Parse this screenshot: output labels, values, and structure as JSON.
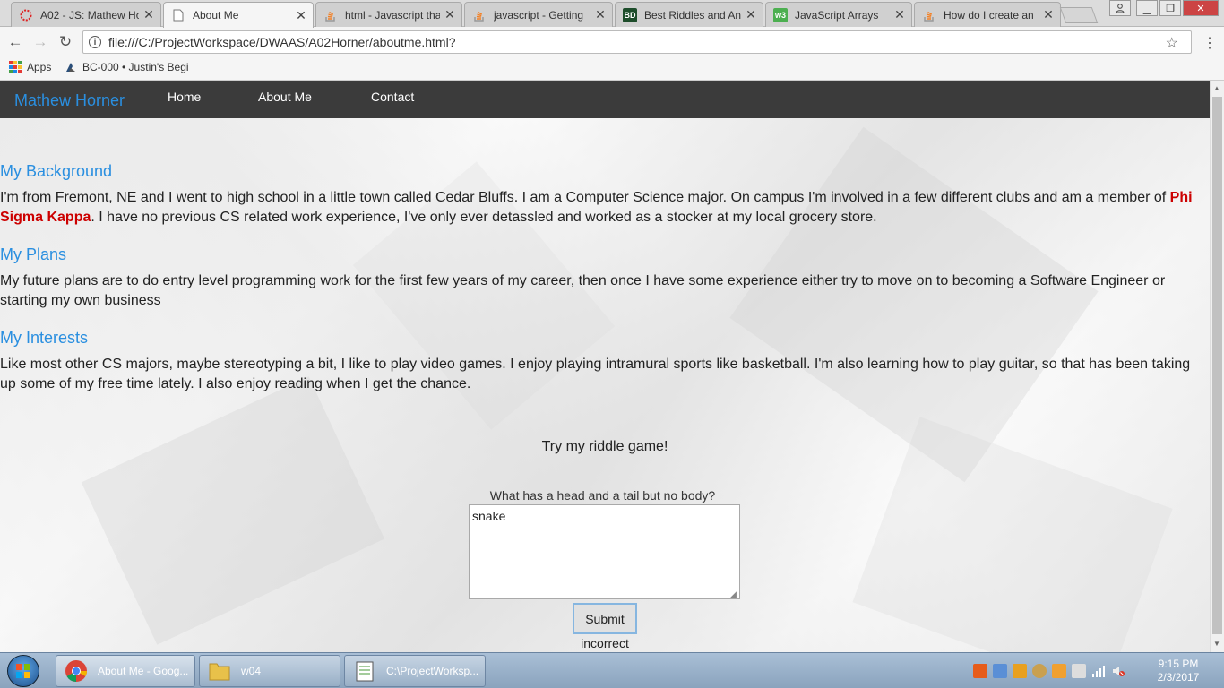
{
  "browser": {
    "tabs": [
      {
        "title": "A02 - JS: Mathew Ho",
        "icon": "ring-icon"
      },
      {
        "title": "About Me",
        "icon": "page-icon"
      },
      {
        "title": "html - Javascript tha",
        "icon": "stackoverflow-icon"
      },
      {
        "title": "javascript - Getting",
        "icon": "stackoverflow-icon"
      },
      {
        "title": "Best Riddles and An",
        "icon": "bd-icon"
      },
      {
        "title": "JavaScript Arrays",
        "icon": "w3-icon"
      },
      {
        "title": "How do I create an",
        "icon": "stackoverflow-icon"
      }
    ],
    "url": "file:///C:/ProjectWorkspace/DWAAS/A02Horner/aboutme.html?",
    "bookmarks": [
      "Apps",
      "BC-000 • Justin's Begi"
    ]
  },
  "site": {
    "brand": "Mathew Horner",
    "nav": [
      "Home",
      "About Me",
      "Contact"
    ]
  },
  "sections": {
    "background": {
      "heading": "My Background",
      "text_before": "I'm from Fremont, NE and I went to high school in a little town called Cedar Bluffs. I am a Computer Science major. On campus I'm involved in a few different clubs and am a member of ",
      "highlight": "Phi Sigma Kappa",
      "text_after": ". I have no previous CS related work experience, I've only ever detassled and worked as a stocker at my local grocery store."
    },
    "plans": {
      "heading": "My Plans",
      "text": "My future plans are to do entry level programming work for the first few years of my career, then once I have some experience either try to move on to becoming a Software Engineer or starting my own business"
    },
    "interests": {
      "heading": "My Interests",
      "text": "Like most other CS majors, maybe stereotyping a bit, I like to play video games. I enjoy playing intramural sports like basketball. I'm also learning how to play guitar, so that has been taking up some of my free time lately. I also enjoy reading when I get the chance."
    }
  },
  "riddle": {
    "title": "Try my riddle game!",
    "question": "What has a head and a tail but no body?",
    "answer": "snake",
    "submit_label": "Submit",
    "result": "incorrect"
  },
  "taskbar": {
    "items": [
      {
        "label": "About Me - Goog...",
        "icon": "chrome-icon"
      },
      {
        "label": "w04",
        "icon": "folder-icon"
      },
      {
        "label": "C:\\ProjectWorksp...",
        "icon": "notepad-icon"
      }
    ],
    "time": "9:15 PM",
    "date": "2/3/2017"
  },
  "colors": {
    "accent": "#2a8fe0",
    "nav_bg": "#3b3b3b",
    "highlight": "#cc0000"
  }
}
